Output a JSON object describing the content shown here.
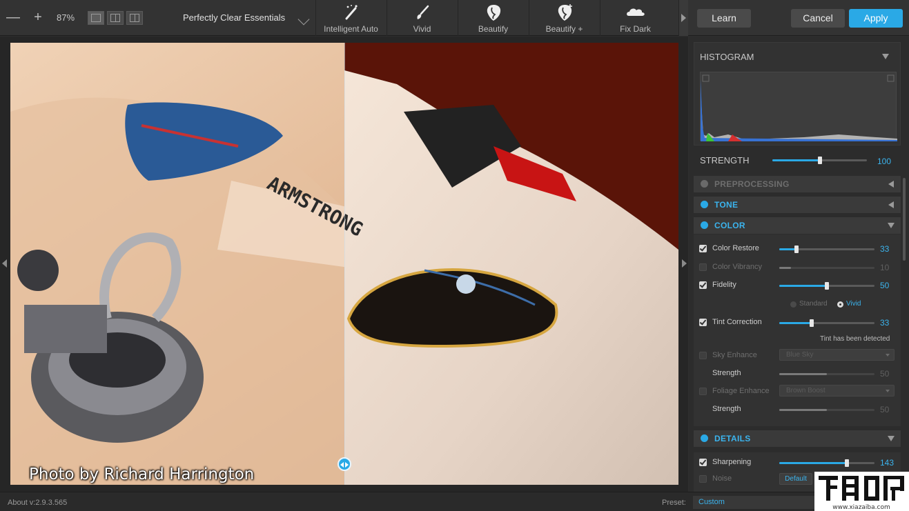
{
  "toolbar": {
    "zoom_out": "—",
    "zoom_in": "+",
    "zoom_level": "87%",
    "preset_name": "Perfectly Clear Essentials",
    "presets": [
      {
        "label": "Intelligent Auto",
        "icon": "magic-wand-icon"
      },
      {
        "label": "Vivid",
        "icon": "brush-icon"
      },
      {
        "label": "Beautify",
        "icon": "face-icon"
      },
      {
        "label": "Beautify +",
        "icon": "face-plus-icon"
      },
      {
        "label": "Fix Dark",
        "icon": "cloud-icon"
      }
    ],
    "learn": "Learn",
    "cancel": "Cancel",
    "apply": "Apply"
  },
  "canvas": {
    "photo_credit": "Photo by Richard Harrington",
    "patch_text": "ARMSTRONG"
  },
  "panel": {
    "histogram_title": "HISTOGRAM",
    "strength_label": "STRENGTH",
    "strength_value": "100",
    "strength_level": 0.5,
    "sections": {
      "preprocessing": "PREPROCESSING",
      "tone": "TONE",
      "color": "COLOR",
      "details": "DETAILS"
    },
    "color": {
      "color_restore": {
        "label": "Color Restore",
        "value": "33",
        "level": 0.18
      },
      "color_vibrancy": {
        "label": "Color Vibrancy",
        "value": "10",
        "level": 0.12
      },
      "fidelity": {
        "label": "Fidelity",
        "value": "50",
        "level": 0.5
      },
      "mode_standard": "Standard",
      "mode_vivid": "Vivid",
      "tint_correction": {
        "label": "Tint Correction",
        "value": "33",
        "level": 0.34
      },
      "tint_note": "Tint has been detected",
      "sky_enhance": {
        "label": "Sky Enhance",
        "option": "Blue Sky"
      },
      "sky_strength": {
        "label": "Strength",
        "value": "50",
        "level": 0.5
      },
      "foliage_enhance": {
        "label": "Foliage Enhance",
        "option": "Brown Boost"
      },
      "foliage_strength": {
        "label": "Strength",
        "value": "50",
        "level": 0.5
      }
    },
    "details": {
      "sharpening": {
        "label": "Sharpening",
        "value": "143",
        "level": 0.71
      },
      "noise": {
        "label": "Noise",
        "button": "Default"
      }
    }
  },
  "statusbar": {
    "about": "About v:2.9.3.565",
    "preset_label": "Preset:",
    "preset_value": "Custom"
  },
  "watermark": {
    "site": "www.xiazaiba.com"
  },
  "colors": {
    "accent": "#2aa9e6",
    "panel_bg": "#2c2c2c",
    "toolbar_bg": "#333333"
  }
}
